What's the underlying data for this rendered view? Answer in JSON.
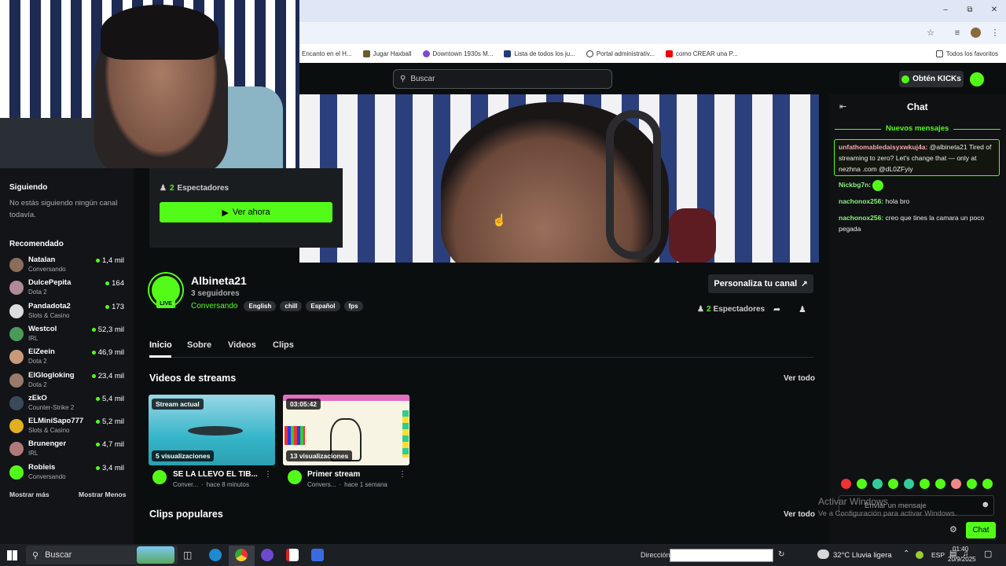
{
  "browser": {
    "bookmarks": [
      "Encanto en el H...",
      "Jugar Haxball",
      "Downtown 1930s M...",
      "Lista de todos los ju...",
      "Portal administrativ...",
      "como CREAR una P...",
      "Todos los favoritos"
    ],
    "colors": {
      "accent": "#53fc18",
      "bg": "#0b0e0f"
    }
  },
  "site": {
    "search_placeholder": "Buscar",
    "get_kicks": "Obtén KICKs"
  },
  "sidebar": {
    "following_title": "Siguiendo",
    "following_empty": "No estás siguiendo ningún canal todavía.",
    "recommended_title": "Recomendado",
    "channels": [
      {
        "name": "Natalan",
        "category": "Conversando",
        "viewers": "1,4 mil",
        "color": "#8a6d5a"
      },
      {
        "name": "DulcePepita",
        "category": "Dota 2",
        "viewers": "164",
        "color": "#b08a96"
      },
      {
        "name": "Pandadota2",
        "category": "Slots & Casino",
        "viewers": "173",
        "color": "#dddddd"
      },
      {
        "name": "Westcol",
        "category": "IRL",
        "viewers": "52,3 mil",
        "color": "#4c9a5a"
      },
      {
        "name": "ElZeein",
        "category": "Dota 2",
        "viewers": "46,9 mil",
        "color": "#c89a7a"
      },
      {
        "name": "ElGlogloking",
        "category": "Dota 2",
        "viewers": "23,4 mil",
        "color": "#9a7a6a"
      },
      {
        "name": "zEkO",
        "category": "Counter-Strike 2",
        "viewers": "5,4 mil",
        "color": "#3a4a5a"
      },
      {
        "name": "ELMiniSapo777",
        "category": "Slots & Casino",
        "viewers": "5,2 mil",
        "color": "#e0b020"
      },
      {
        "name": "Brunenger",
        "category": "IRL",
        "viewers": "4,7 mil",
        "color": "#b07a7a"
      },
      {
        "name": "Robleis",
        "category": "Conversando",
        "viewers": "3,4 mil",
        "color": "#53fc18"
      }
    ],
    "show_more": "Mostrar más",
    "show_less": "Mostrar Menos"
  },
  "card": {
    "viewers_num": "2",
    "viewers_label": "Espectadores",
    "watch_now": "Ver ahora"
  },
  "channel": {
    "name": "Albineta21",
    "followers": "3 seguidores",
    "live_badge": "LIVE",
    "category": "Conversando",
    "tags": [
      "English",
      "chill",
      "Español",
      "fps"
    ],
    "customize": "Personaliza tu canal",
    "viewers_num": "2",
    "viewers_label": "Espectadores"
  },
  "tabs": [
    "Inicio",
    "Sobre",
    "Videos",
    "Clips"
  ],
  "videos_section": {
    "title": "Videos de streams",
    "see_all": "Ver todo",
    "items": [
      {
        "badge": "Stream actual",
        "views": "5 visualizaciones",
        "title": "SE LA LLEVO EL TIB...",
        "category": "Conver...",
        "time": "hace 8 minutos"
      },
      {
        "badge": "03:05:42",
        "views": "13 visualizaciones",
        "title": "Primer stream",
        "category": "Convers...",
        "time": "hace 1 semana"
      }
    ]
  },
  "clips_section": {
    "title": "Clips populares",
    "see_all": "Ver todo"
  },
  "chat": {
    "title": "Chat",
    "new_messages": "Nuevos mensajes",
    "messages": [
      {
        "user": "unfathomabledaisyxwkuj4a:",
        "text": "@albineta21 Tired of streaming to zero? Let's change that — only at nezhna .com @dL0ZFyiy",
        "user_color": "#f7a6b6"
      },
      {
        "user": "Nickbg7n:",
        "text": "",
        "user_color": "#8cf57a"
      },
      {
        "user": "nachonox256:",
        "text": "hola bro",
        "user_color": "#8cf57a"
      },
      {
        "user": "nachonox256:",
        "text": "creo que tines la camara un poco pegada",
        "user_color": "#8cf57a"
      }
    ],
    "input_placeholder": "Enviar un mensaje",
    "send": "Chat",
    "activate_windows": "Activar Windows",
    "activate_windows_sub": "Ve a Configuración para activar Windows."
  },
  "taskbar": {
    "search": "Buscar",
    "address_label": "Dirección",
    "weather": "32°C  Lluvia ligera",
    "lang": "ESP",
    "time": "01:40",
    "date": "20/9/2025"
  }
}
